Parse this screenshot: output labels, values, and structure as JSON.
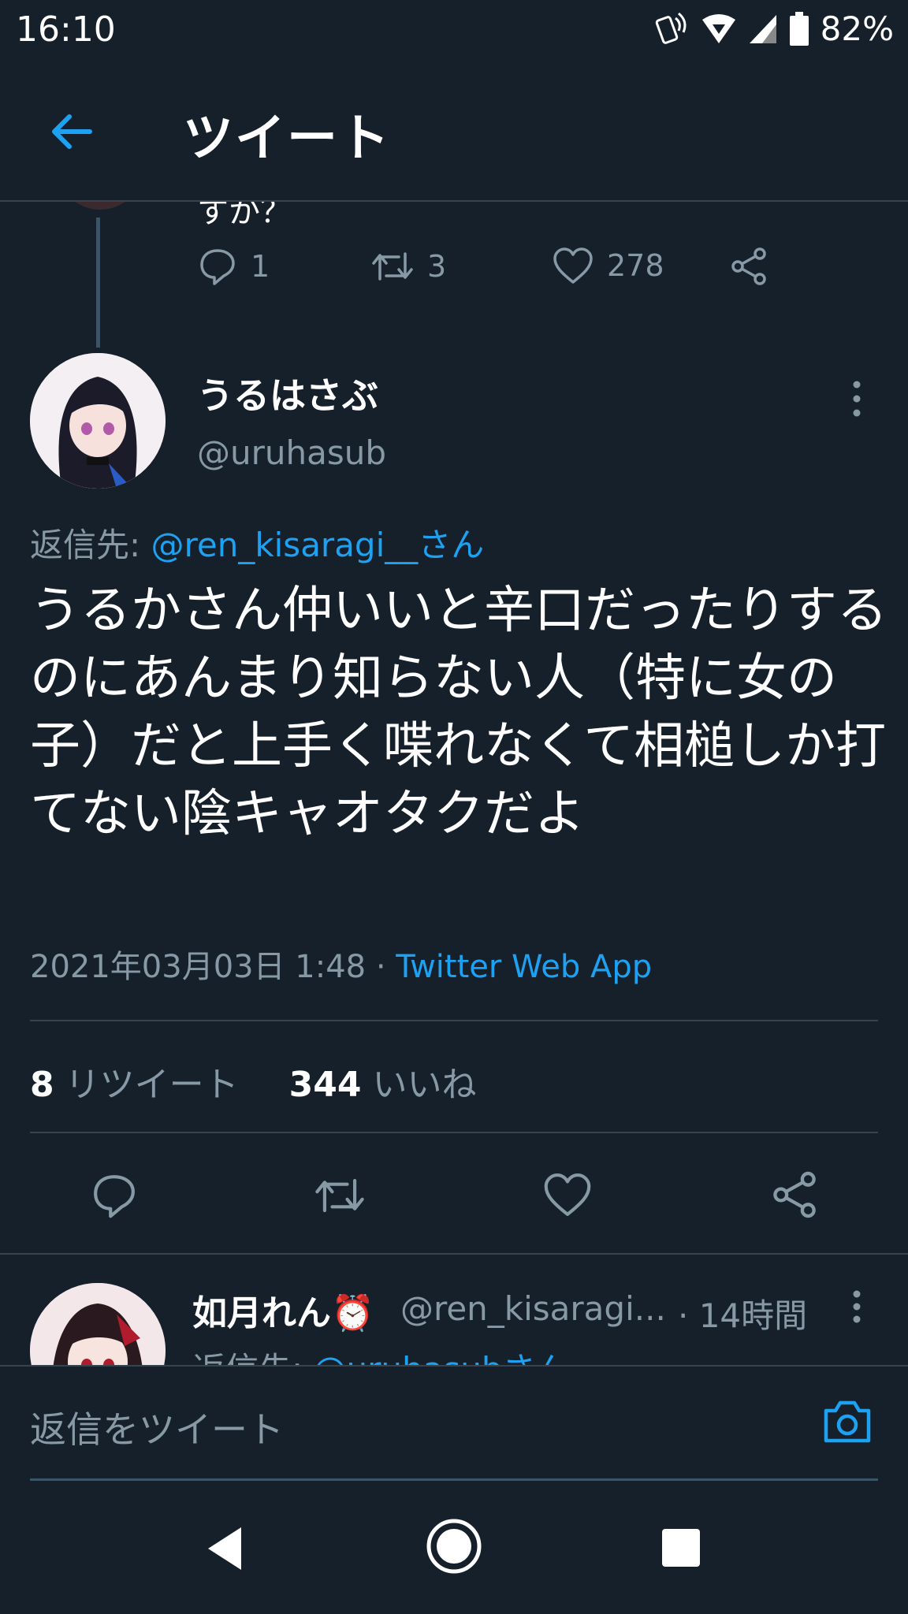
{
  "status_bar": {
    "time": "16:10",
    "battery": "82%",
    "icons": [
      "nfc-phone-icon",
      "wifi-icon",
      "signal-icon",
      "battery-icon"
    ]
  },
  "header": {
    "title": "ツイート",
    "back_icon": "back-arrow-icon"
  },
  "previous_tweet": {
    "cut_text": "すか？",
    "reply_count": "1",
    "retweet_count": "3",
    "like_count": "278"
  },
  "tweet": {
    "display_name": "うるはさぶ",
    "handle": "@uruhasub",
    "reply_to_label": "返信先: ",
    "reply_to_handle": "@ren_kisaragi__さん",
    "text": "うるかさん仲いいと辛口だったりするのにあんまり知らない人（特に女の子）だと上手く喋れなくて相槌しか打てない陰キャオタクだよ",
    "timestamp": "2021年03月03日 1:48 · ",
    "source": "Twitter Web App",
    "retweet_count": "8",
    "retweet_label": " リツイート",
    "like_count": "344",
    "like_label": " いいね"
  },
  "reply": {
    "display_name": "如月れん⏰",
    "handle": "@ren_kisaragi...",
    "time": "· 14時間",
    "reply_to_label": "返信先: ",
    "reply_to_handle": "@uruhasubさん"
  },
  "composer": {
    "placeholder": "返信をツイート"
  },
  "colors": {
    "background": "#15202b",
    "accent": "#1da1f2",
    "muted": "#8899a6",
    "divider": "#38444d"
  }
}
